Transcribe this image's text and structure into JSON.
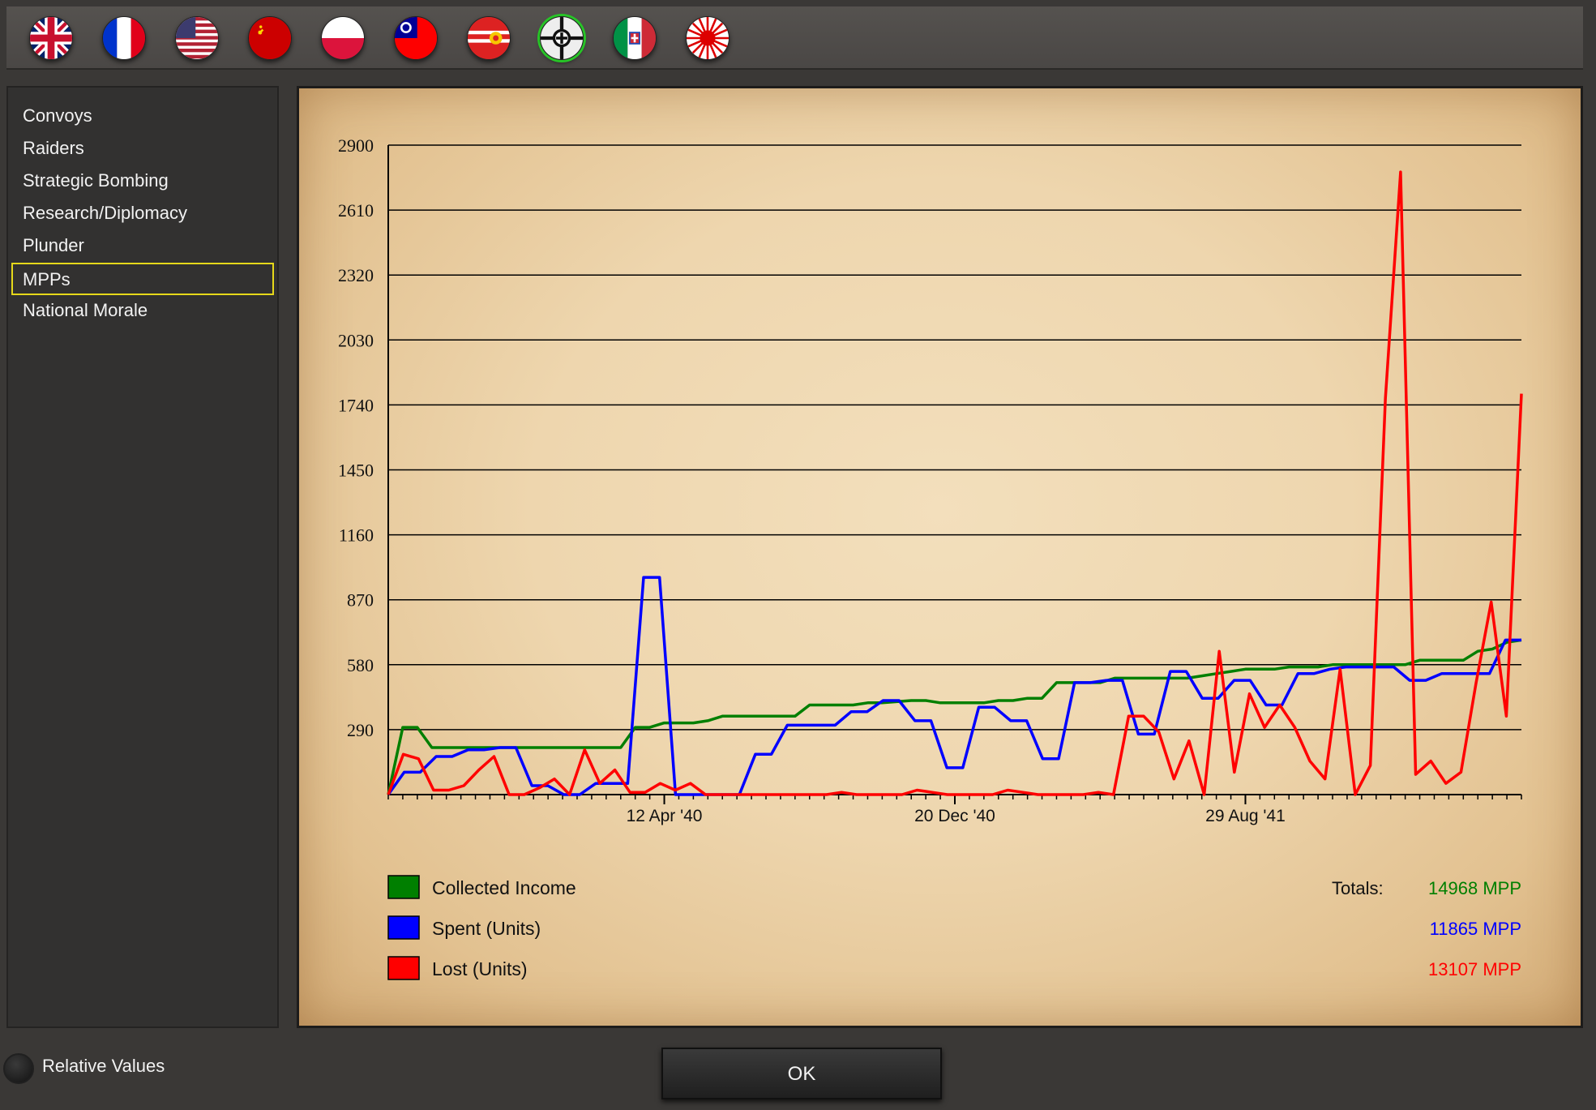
{
  "flags": [
    {
      "icon": "uk-flag-icon"
    },
    {
      "icon": "france-flag-icon"
    },
    {
      "icon": "usa-flag-icon"
    },
    {
      "icon": "ussr-flag-icon"
    },
    {
      "icon": "poland-flag-icon"
    },
    {
      "icon": "china-flag-icon"
    },
    {
      "icon": "mongolia-flag-icon"
    },
    {
      "icon": "germany-flag-icon",
      "selected": true
    },
    {
      "icon": "italy-flag-icon"
    },
    {
      "icon": "japan-flag-icon"
    }
  ],
  "sidebar": {
    "items": [
      {
        "label": "Convoys"
      },
      {
        "label": "Raiders"
      },
      {
        "label": "Strategic Bombing"
      },
      {
        "label": "Research/Diplomacy"
      },
      {
        "label": "Plunder"
      },
      {
        "label": "MPPs",
        "selected": true
      },
      {
        "label": "National Morale"
      }
    ]
  },
  "chart_data": {
    "type": "line",
    "ylim": [
      0,
      2900
    ],
    "yticks": [
      "290",
      "580",
      "870",
      "1160",
      "1450",
      "1740",
      "2030",
      "2320",
      "2610",
      "2900"
    ],
    "xticks": [
      {
        "label": "12 Apr '40",
        "i": 19
      },
      {
        "label": "20 Dec '40",
        "i": 39
      },
      {
        "label": "29 Aug '41",
        "i": 59
      }
    ],
    "grid": true,
    "series": [
      {
        "name": "Collected Income",
        "color": "#007f00",
        "total": "14968 MPP",
        "values": [
          0,
          300,
          300,
          210,
          210,
          210,
          210,
          210,
          210,
          210,
          210,
          210,
          210,
          210,
          210,
          210,
          210,
          300,
          300,
          320,
          320,
          320,
          330,
          350,
          350,
          350,
          350,
          350,
          350,
          400,
          400,
          400,
          400,
          410,
          410,
          415,
          420,
          420,
          410,
          410,
          410,
          410,
          420,
          420,
          430,
          430,
          500,
          500,
          500,
          500,
          520,
          520,
          520,
          520,
          520,
          520,
          530,
          540,
          550,
          560,
          560,
          560,
          570,
          570,
          570,
          580,
          580,
          580,
          580,
          580,
          580,
          600,
          600,
          600,
          600,
          640,
          650,
          680,
          690
        ]
      },
      {
        "name": "Spent (Units)",
        "color": "#0000ff",
        "total": "11865 MPP",
        "values": [
          0,
          100,
          100,
          170,
          170,
          200,
          200,
          210,
          210,
          40,
          40,
          0,
          0,
          50,
          50,
          50,
          970,
          970,
          0,
          0,
          0,
          0,
          0,
          180,
          180,
          310,
          310,
          310,
          310,
          370,
          370,
          420,
          420,
          330,
          330,
          120,
          120,
          390,
          390,
          330,
          330,
          160,
          160,
          500,
          500,
          510,
          510,
          270,
          270,
          550,
          550,
          430,
          430,
          510,
          510,
          400,
          400,
          540,
          540,
          560,
          570,
          570,
          570,
          570,
          510,
          510,
          540,
          540,
          540,
          540,
          690,
          690
        ]
      },
      {
        "name": "Lost (Units)",
        "color": "#ff0000",
        "total": "13107 MPP",
        "values": [
          0,
          180,
          160,
          20,
          20,
          40,
          110,
          170,
          0,
          0,
          30,
          70,
          0,
          200,
          50,
          110,
          10,
          10,
          50,
          20,
          50,
          0,
          0,
          0,
          0,
          0,
          0,
          0,
          0,
          0,
          10,
          0,
          0,
          0,
          0,
          20,
          10,
          0,
          0,
          0,
          0,
          20,
          10,
          0,
          0,
          0,
          0,
          10,
          0,
          350,
          350,
          280,
          70,
          240,
          0,
          640,
          100,
          450,
          300,
          400,
          300,
          150,
          70,
          560,
          0,
          130,
          1770,
          2780,
          90,
          150,
          50,
          100,
          500,
          860,
          350,
          1790
        ]
      }
    ],
    "totals_label": "Totals:"
  },
  "footer": {
    "relative_label": "Relative Values",
    "ok_label": "OK"
  }
}
